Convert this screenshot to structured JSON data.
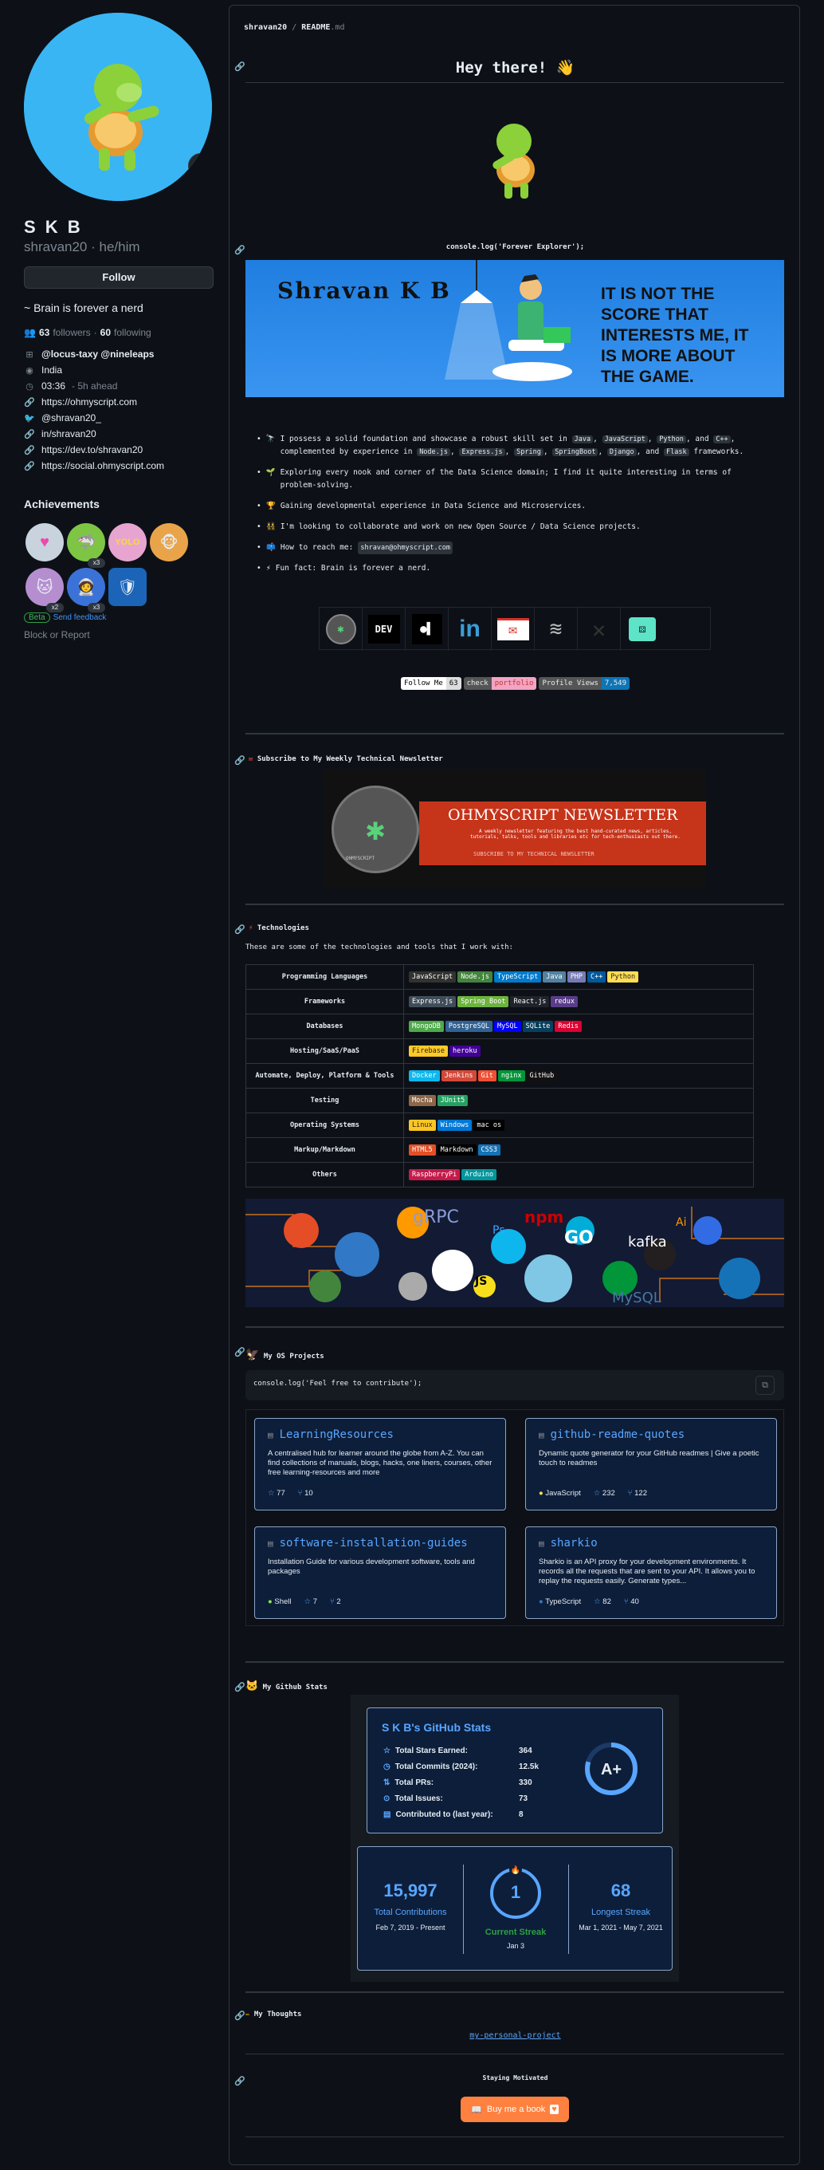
{
  "profile": {
    "name": "S K B",
    "login": "shravan20",
    "pronouns": "he/him",
    "follow_label": "Follow",
    "bio": "~ Brain is forever a nerd",
    "followers_count": "63",
    "followers_label": "followers",
    "following_count": "60",
    "following_label": "following",
    "status_emoji": "🏂"
  },
  "vcard": {
    "org": "@locus-taxy @nineleaps",
    "location": "India",
    "time": "03:36",
    "time_diff": "- 5h ahead",
    "website": "https://ohmyscript.com",
    "twitter": "@shravan20_",
    "linkedin": "in/shravan20",
    "devto": "https://dev.to/shravan20",
    "social": "https://social.ohmyscript.com"
  },
  "achievements": {
    "title": "Achievements",
    "badges": [
      {
        "icon": "heart",
        "count": ""
      },
      {
        "icon": "pull-shark",
        "count": "x3"
      },
      {
        "icon": "yolo",
        "count": ""
      },
      {
        "icon": "starstruck",
        "count": ""
      },
      {
        "icon": "quickdraw",
        "count": "x2"
      },
      {
        "icon": "pair-extraordinaire",
        "count": "x3"
      },
      {
        "icon": "arctic-code-vault",
        "count": ""
      }
    ],
    "beta": "Beta",
    "feedback": "Send feedback"
  },
  "block_label": "Block or Report",
  "readme": {
    "path_user": "shravan20",
    "path_sep": "/",
    "path_file": "README",
    "path_ext": ".md",
    "greeting": "Hey there! 👋",
    "console_line": "console.log('Forever Explorer');",
    "banner_name": "Shravan K B",
    "banner_quote": "IT IS NOT THE SCORE THAT INTERESTS ME, IT IS MORE ABOUT THE GAME.",
    "bullets": [
      {
        "emoji": "🔭",
        "pre": "I possess a solid foundation and showcase a robust skill set in",
        "codes1": [
          "Java",
          "JavaScript",
          "Python"
        ],
        "mid": "and",
        "codes2": [
          "C++"
        ],
        "post": ", complemented by experience in",
        "codes3": [
          "Node.js",
          "Express.js",
          "Spring",
          "SpringBoot",
          "Django"
        ],
        "and2": "and",
        "codes4": [
          "Flask"
        ],
        "end": "frameworks."
      },
      {
        "emoji": "🌱",
        "text": "Exploring every nook and corner of the Data Science domain; I find it quite interesting in terms of problem-solving."
      },
      {
        "emoji": "🏆",
        "text": "Gaining developmental experience in Data Science and Microservices."
      },
      {
        "emoji": "👯",
        "text": "I'm looking to collaborate and work on new Open Source / Data Science projects."
      },
      {
        "emoji": "📫",
        "text": "How to reach me:",
        "code": "shravan@ohmyscript.com"
      },
      {
        "emoji": "⚡",
        "text": "Fun fact: Brain is forever a nerd."
      }
    ],
    "social_icons": [
      "ohmyscript-icon",
      "devto-icon",
      "medium-icon",
      "linkedin-icon",
      "gmail-icon",
      "stackoverflow-icon",
      "x-icon",
      "more-icon"
    ],
    "devto_label": "DEV",
    "linkedin_label": "in",
    "shields": [
      {
        "l": "Follow Me",
        "r": "63"
      },
      {
        "l": "check",
        "r": "portfolio"
      },
      {
        "l": "Profile Views",
        "r": "7,549"
      }
    ],
    "newsletter_heading": "Subscribe to My Weekly Technical Newsletter",
    "newsletter_title": "OHMYSCRIPT NEWSLETTER",
    "newsletter_sub": "A weekly newsletter featuring the best hand-curated news, articles, tutorials, talks, tools and libraries etc for tech-enthusiasts out there.",
    "newsletter_cta": "SUBSCRIBE TO MY TECHNICAL NEWSLETTER",
    "newsletter_logo": "OHMYSCRIPT",
    "tech_heading": "Technologies",
    "tech_intro": "These are some of the technologies and tools that I work with:",
    "tech_rows": [
      {
        "cat": "Programming Languages",
        "items": [
          {
            "t": "JavaScript",
            "c": "#323330"
          },
          {
            "t": "Node.js",
            "c": "#43853d"
          },
          {
            "t": "TypeScript",
            "c": "#007acc"
          },
          {
            "t": "Java",
            "c": "#5382a1"
          },
          {
            "t": "PHP",
            "c": "#777bb4"
          },
          {
            "t": "C++",
            "c": "#00599c"
          },
          {
            "t": "Python",
            "c": "#ffdd54"
          }
        ]
      },
      {
        "cat": "Frameworks",
        "items": [
          {
            "t": "Express.js",
            "c": "#404d59"
          },
          {
            "t": "Spring Boot",
            "c": "#6db33f"
          },
          {
            "t": "React.js",
            "c": "#20232a"
          },
          {
            "t": "redux",
            "c": "#593d88"
          }
        ]
      },
      {
        "cat": "Databases",
        "items": [
          {
            "t": "MongoDB",
            "c": "#4ea94b"
          },
          {
            "t": "PostgreSQL",
            "c": "#316192"
          },
          {
            "t": "MySQL",
            "c": "#00f"
          },
          {
            "t": "SQLite",
            "c": "#07405e"
          },
          {
            "t": "Redis",
            "c": "#dd0031"
          }
        ]
      },
      {
        "cat": "Hosting/SaaS/PaaS",
        "items": [
          {
            "t": "Firebase",
            "c": "#ffca28"
          },
          {
            "t": "heroku",
            "c": "#430098"
          }
        ]
      },
      {
        "cat": "Automate, Deploy, Platform & Tools",
        "items": [
          {
            "t": "Docker",
            "c": "#0db7ed"
          },
          {
            "t": "Jenkins",
            "c": "#d24939"
          },
          {
            "t": "Git",
            "c": "#f05033"
          },
          {
            "t": "nginx",
            "c": "#009639"
          },
          {
            "t": "GitHub",
            "c": "#121011"
          }
        ]
      },
      {
        "cat": "Testing",
        "items": [
          {
            "t": "Mocha",
            "c": "#8d6748"
          },
          {
            "t": "JUnit5",
            "c": "#25a162"
          }
        ]
      },
      {
        "cat": "Operating Systems",
        "items": [
          {
            "t": "Linux",
            "c": "#fcc624"
          },
          {
            "t": "Windows",
            "c": "#0078d6"
          },
          {
            "t": "mac os",
            "c": "#000000"
          }
        ]
      },
      {
        "cat": "Markup/Markdown",
        "items": [
          {
            "t": "HTML5",
            "c": "#e34f26"
          },
          {
            "t": "Markdown",
            "c": "#000000"
          },
          {
            "t": "CSS3",
            "c": "#1572b6"
          }
        ]
      },
      {
        "cat": "Others",
        "items": [
          {
            "t": "RaspberryPi",
            "c": "#c51a4a"
          },
          {
            "t": "Arduino",
            "c": "#00979d"
          }
        ]
      }
    ],
    "tech_banner_words": [
      "gRPC",
      "npm",
      "GO",
      "kafka",
      "MySQL",
      "JS",
      "Ps",
      "Ai"
    ],
    "os_heading": "My OS Projects",
    "os_code": "console.log('Feel free to contribute');",
    "repos": [
      {
        "name": "LearningResources",
        "desc": "A centralised hub for learner around the globe from A-Z. You can find collections of manuals, blogs, hacks, one liners, courses, other free learning-resources and more",
        "lang": "",
        "lang_color": "",
        "stars": "77",
        "forks": "10"
      },
      {
        "name": "github-readme-quotes",
        "desc": "Dynamic quote generator for your GitHub readmes | Give a poetic touch to readmes",
        "lang": "JavaScript",
        "lang_color": "#f1e05a",
        "stars": "232",
        "forks": "122"
      },
      {
        "name": "software-installation-guides",
        "desc": "Installation Guide for various development software, tools and packages",
        "lang": "Shell",
        "lang_color": "#89e051",
        "stars": "7",
        "forks": "2"
      },
      {
        "name": "sharkio",
        "desc": "Sharkio is an API proxy for your development environments. It records all the requests that are sent to your API. It allows you to replay the requests easily. Generate types...",
        "lang": "TypeScript",
        "lang_color": "#3178c6",
        "stars": "82",
        "forks": "40"
      }
    ],
    "stats_heading": "My Github Stats",
    "stats": {
      "title": "S K B's GitHub Stats",
      "rows": [
        {
          "l": "Total Stars Earned:",
          "v": "364"
        },
        {
          "l": "Total Commits (2024):",
          "v": "12.5k"
        },
        {
          "l": "Total PRs:",
          "v": "330"
        },
        {
          "l": "Total Issues:",
          "v": "73"
        },
        {
          "l": "Contributed to (last year):",
          "v": "8"
        }
      ],
      "grade": "A+"
    },
    "streak": {
      "total": "15,997",
      "total_label": "Total Contributions",
      "total_range": "Feb 7, 2019 - Present",
      "current": "1",
      "current_label": "Current Streak",
      "current_date": "Jan 3",
      "longest": "68",
      "longest_label": "Longest Streak",
      "longest_range": "Mar 1, 2021 - May 7, 2021"
    },
    "thoughts_heading": "My Thoughts",
    "thoughts_alt": "my-personal-project",
    "motivated": "Staying Motivated",
    "coffee": "Buy me a book"
  },
  "colors": {
    "bg": "#0d1117",
    "accent": "#58a6ff",
    "card": "#0d1e3a",
    "orange": "#ff813f"
  }
}
